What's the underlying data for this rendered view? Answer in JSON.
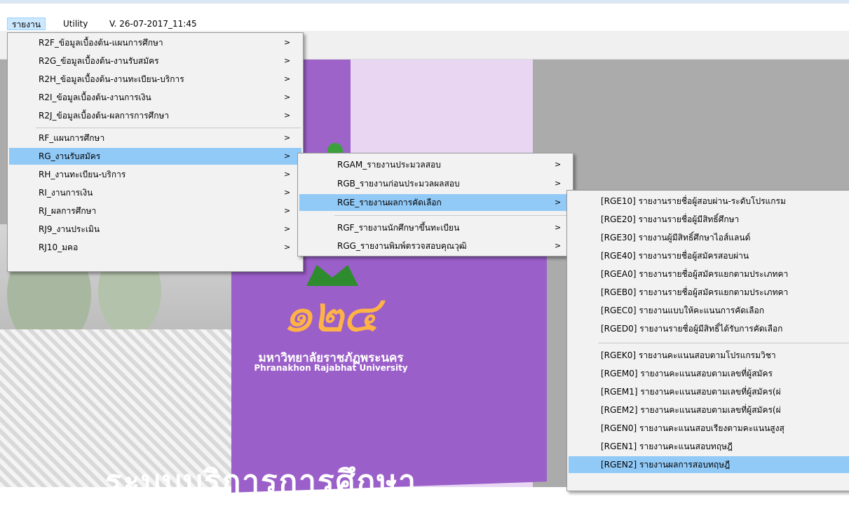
{
  "menubar": {
    "items": [
      "รายงาน",
      "Utility",
      "V. 26-07-2017_11:45"
    ]
  },
  "background": {
    "university_th": "มหาวิทยาลัยราชภัฏพระนคร",
    "university_en": "Phranakhon Rajabhat University",
    "logo_number": "๑๒๔",
    "banner_title": "ระบบบริการการศึกษา"
  },
  "menu1": {
    "items": [
      "R2F_ข้อมูลเบื้องต้น-แผนการศึกษา",
      "R2G_ข้อมูลเบื้องต้น-งานรับสมัคร",
      "R2H_ข้อมูลเบื้องต้น-งานทะเบียน-บริการ",
      "R2I_ข้อมูลเบื้องต้น-งานการเงิน",
      "R2J_ข้อมูลเบื้องต้น-ผลการการศึกษา",
      "RF_แผนการศึกษา",
      "RG_งานรับสมัคร",
      "RH_งานทะเบียน-บริการ",
      "RI_งานการเงิน",
      "RJ_ผลการศึกษา",
      "RJ9_งานประเมิน",
      "RJ10_มคอ"
    ],
    "arrow": ">"
  },
  "menu2": {
    "items": [
      "RGAM_รายงานประมวลสอบ",
      "RGB_รายงานก่อนประมวลผลสอบ",
      "RGE_รายงานผลการคัดเลือก",
      "RGF_รายงานนักศึกษาขึ้นทะเบียน",
      "RGG_รายงานพิมพ์ตรวจสอบคุณวุฒิ"
    ]
  },
  "menu3": {
    "items": [
      "[RGE10] รายงานรายชื่อผู้สอบผ่าน-ระดับโปรแกรม",
      "[RGE20] รายงานรายชื่อผู้มีสิทธิ์ศึกษา",
      "[RGE30] รายงานผู้มีสิทธิ์ศึกษาไอส์แลนด์",
      "[RGE40] รายงานรายชื่อผู้สมัครสอบผ่าน",
      "[RGEA0] รายงานรายชื่อผู้สมัครแยกตามประเภทคา",
      "[RGEB0] รายงานรายชื่อผู้สมัครแยกตามประเภทคา",
      "[RGEC0] รายงานแบบให้คะแนนการคัดเลือก",
      "[RGED0] รายงานรายชื่อผู้มีสิทธิ์ได้รับการคัดเลือก",
      "[RGEK0] รายงานคะแนนสอบตามโปรแกรมวิชา",
      "[RGEM0] รายงานคะแนนสอบตามเลขที่ผู้สมัคร",
      "[RGEM1] รายงานคะแนนสอบตามเลขที่ผู้สมัคร(ผ่",
      "[RGEM2] รายงานคะแนนสอบตามเลขที่ผู้สมัคร(ผ่",
      "[RGEN0] รายงานคะแนนสอบเรียงตามคะแนนสูงสุ",
      "[RGEN1] รายงานคะแนนสอบทฤษฎี",
      "[RGEN2] รายงานผลการสอบทฤษฎี"
    ]
  },
  "colors": {
    "highlight": "#91c9f7",
    "menu_bg": "#f2f2f2",
    "workspace": "#ababab",
    "purple": "#b07cd6"
  }
}
